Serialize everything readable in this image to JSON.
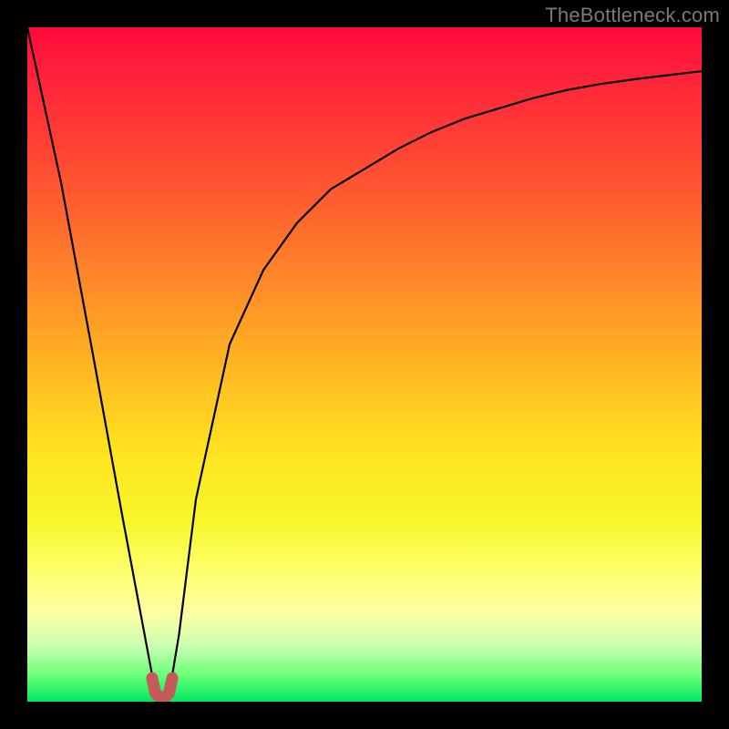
{
  "watermark": "TheBottleneck.com",
  "chart_data": {
    "type": "line",
    "title": "",
    "xlabel": "",
    "ylabel": "",
    "xlim": [
      0,
      1
    ],
    "ylim": [
      0,
      100
    ],
    "series": [
      {
        "name": "curve",
        "x": [
          0.0,
          0.05,
          0.1,
          0.14,
          0.17,
          0.185,
          0.195,
          0.2,
          0.208,
          0.215,
          0.225,
          0.25,
          0.3,
          0.35,
          0.4,
          0.45,
          0.5,
          0.55,
          0.6,
          0.65,
          0.7,
          0.75,
          0.8,
          0.85,
          0.9,
          0.95,
          1.0
        ],
        "values": [
          100,
          77,
          50,
          28,
          12,
          4,
          1,
          0,
          1,
          4,
          10,
          30,
          53,
          64,
          71,
          76,
          79,
          82,
          84.5,
          86.5,
          88,
          89.5,
          90.7,
          91.6,
          92.3,
          92.9,
          93.5
        ]
      }
    ],
    "marker": {
      "name": "u-marker",
      "x": [
        0.185,
        0.19,
        0.2,
        0.21,
        0.215
      ],
      "values": [
        3.5,
        1.2,
        0.4,
        1.2,
        3.5
      ]
    },
    "colors": {
      "curve": "#000000",
      "marker": "#c45a5a",
      "gradient_top": "#ff0a3c",
      "gradient_bottom": "#00e85e"
    }
  }
}
